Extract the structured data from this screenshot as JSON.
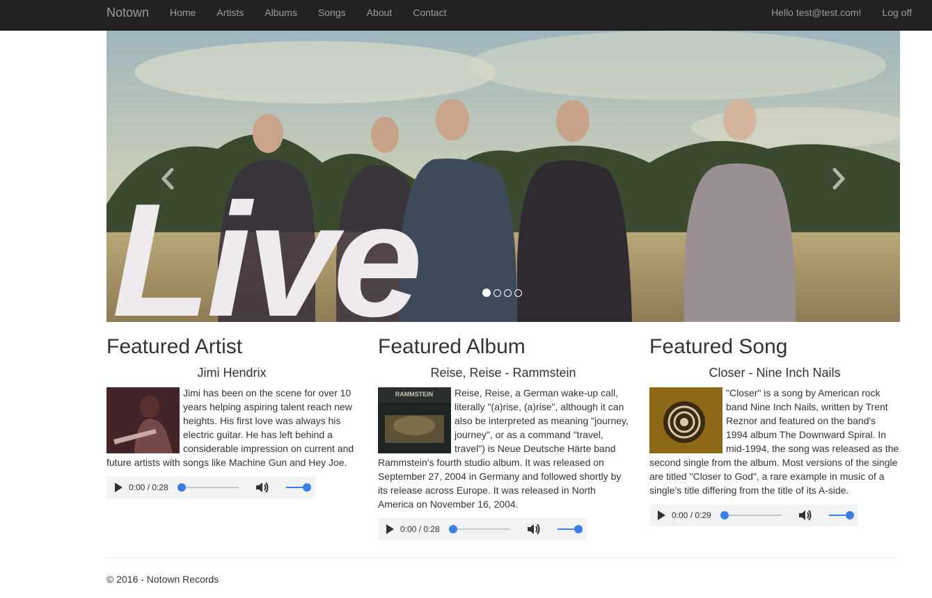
{
  "navbar": {
    "brand": "Notown",
    "links": [
      "Home",
      "Artists",
      "Albums",
      "Songs",
      "About",
      "Contact"
    ],
    "greeting": "Hello test@test.com!",
    "logoff": "Log off"
  },
  "carousel": {
    "overlay_text": "Live",
    "slide_count": 4,
    "active_slide": 1,
    "prev_icon": "chevron-left-icon",
    "next_icon": "chevron-right-icon"
  },
  "featured": [
    {
      "heading": "Featured Artist",
      "subtitle": "Jimi Hendrix",
      "description": "Jimi has been on the scene for over 10 years helping aspiring talent reach new heights. His first love was always his electric guitar. He has left behind a considerable impression on current and future artists with songs like Machine Gun and Hey Joe.",
      "audio_time": "0:00 / 0:28"
    },
    {
      "heading": "Featured Album",
      "subtitle": "Reise, Reise - Rammstein",
      "description": "Reise, Reise, a German wake-up call, literally \"(a)rise, (a)rise\", although it can also be interpreted as meaning \"journey, journey\", or as a command \"travel, travel\") is Neue Deutsche Härte band Rammstein's fourth studio album. It was released on September 27, 2004 in Germany and followed shortly by its release across Europe. It was released in North America on November 16, 2004.",
      "audio_time": "0:00 / 0:28",
      "cover_text": "RAMMSTEIN"
    },
    {
      "heading": "Featured Song",
      "subtitle": "Closer - Nine Inch Nails",
      "description": "\"Closer\" is a song by American rock band Nine Inch Nails, written by Trent Reznor and featured on the band's 1994 album The Downward Spiral. In mid-1994, the song was released as the second single from the album. Most versions of the single are titled \"Closer to God\", a rare example in music of a single's title differing from the title of its A-side.",
      "audio_time": "0:00 / 0:29"
    }
  ],
  "footer": {
    "text": "© 2016 - Notown Records"
  }
}
